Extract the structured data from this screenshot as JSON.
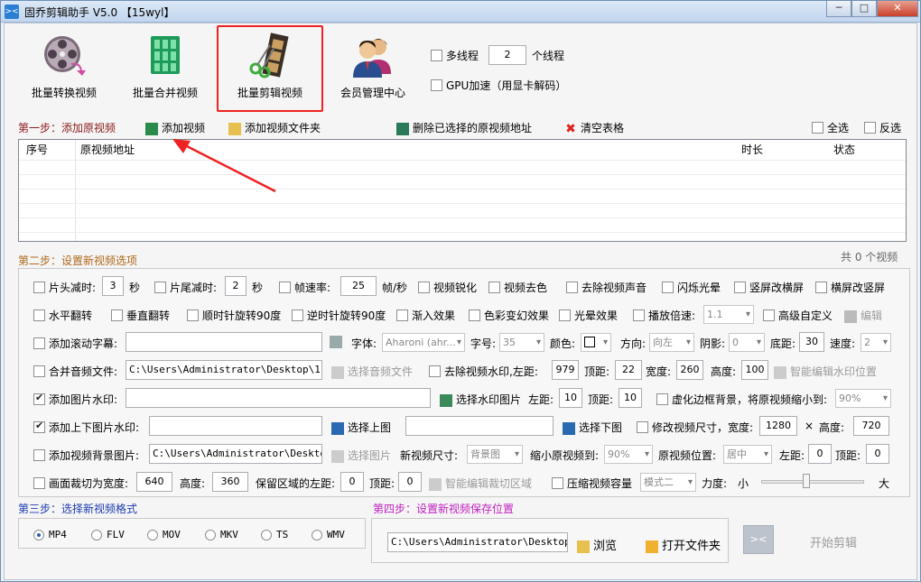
{
  "window": {
    "title": "固乔剪辑助手 V5.0  【15wyl】",
    "min": "─",
    "max": "□",
    "close": "✕"
  },
  "toolbar": {
    "convert": "批量转换视频",
    "merge": "批量合并视频",
    "clip": "批量剪辑视频",
    "member": "会员管理中心",
    "multithread": "多线程",
    "threads": "2",
    "threads_unit": "个线程",
    "gpu": "GPU加速（用显卡解码）"
  },
  "step1": {
    "title": "第一步：添加原视频",
    "add_video": "添加视频",
    "add_folder": "添加视频文件夹",
    "delete_selected": "删除已选择的原视频地址",
    "clear_table": "清空表格",
    "select_all": "全选",
    "invert": "反选"
  },
  "table": {
    "columns": [
      "序号",
      "原视频地址",
      "时长",
      "状态"
    ],
    "count": "共 0 个视频"
  },
  "step2": {
    "title": "第二步：设置新视频选项",
    "row1": {
      "head_cut": "片头减时:",
      "head_val": "3",
      "sec1": "秒",
      "tail_cut": "片尾减时:",
      "tail_val": "2",
      "sec2": "秒",
      "fps": "帧速率:",
      "fps_val": "25",
      "fps_unit": "帧/秒",
      "sharpen": "视频锐化",
      "decolor": "视频去色",
      "mute": "去除视频声音",
      "flash": "闪烁光晕",
      "v2h": "竖屏改横屏",
      "h2v": "横屏改竖屏"
    },
    "row2": {
      "hflip": "水平翻转",
      "vflip": "垂直翻转",
      "cw90": "顺时针旋转90度",
      "ccw90": "逆时针旋转90度",
      "fadein": "渐入效果",
      "color": "色彩变幻效果",
      "halo": "光晕效果",
      "speed": "播放倍速:",
      "speed_val": "1.1",
      "advanced": "高级自定义",
      "edit": "编辑"
    },
    "row3": {
      "subtitle": "添加滚动字幕:",
      "subtitle_val": "",
      "font": "字体:",
      "font_val": "Aharoni (ahr...",
      "size": "字号:",
      "size_val": "35",
      "color": "颜色:",
      "direction": "方向:",
      "direction_val": "向左",
      "shadow": "阴影:",
      "shadow_val": "0",
      "bottom": "底距:",
      "bottom_val": "30",
      "speed": "速度:",
      "speed_val": "2"
    },
    "row4": {
      "audio": "合并音频文件:",
      "audio_val": "C:\\Users\\Administrator\\Desktop\\1.mp3",
      "choose_audio": "选择音频文件",
      "remove_wm": "去除视频水印,左距:",
      "left_val": "979",
      "top": "顶距:",
      "top_val": "22",
      "width": "宽度:",
      "width_val": "260",
      "height": "高度:",
      "height_val": "100",
      "smart_wm": "智能编辑水印位置"
    },
    "row5": {
      "img_wm": "添加图片水印:",
      "img_wm_val": "",
      "choose_wm": "选择水印图片",
      "left": "左距:",
      "left_val": "10",
      "top": "顶距:",
      "top_val": "10",
      "blur_bg": "虚化边框背景，将原视频缩小到:",
      "blur_val": "90%"
    },
    "row6": {
      "updown": "添加上下图片水印:",
      "up_val": "",
      "choose_up": "选择上图",
      "down_val": "",
      "choose_down": "选择下图",
      "resize": "修改视频尺寸，宽度:",
      "w_val": "1280",
      "x": "×",
      "h": "高度:",
      "h_val": "720"
    },
    "row7": {
      "bg_img": "添加视频背景图片:",
      "bg_val": "C:\\Users\\Administrator\\Desktop\\t",
      "choose_img": "选择图片",
      "new_size": "新视频尺寸:",
      "new_size_val": "背景图",
      "shrink": "缩小原视频到:",
      "shrink_val": "90%",
      "pos": "原视频位置:",
      "pos_val": "居中",
      "left": "左距:",
      "left_val": "0",
      "top": "顶距:",
      "top_val": "0"
    },
    "row8": {
      "crop": "画面裁切为宽度:",
      "crop_w": "640",
      "height": "高度:",
      "crop_h": "360",
      "keep_left": "保留区域的左距:",
      "keep_left_val": "0",
      "top": "顶距:",
      "top_val": "0",
      "smart_crop": "智能编辑裁切区域",
      "compress": "压缩视频容量",
      "mode_val": "模式二",
      "force": "力度:",
      "small": "小",
      "big": "大",
      "force_level": 0.43
    }
  },
  "step3": {
    "title": "第三步：选择新视频格式",
    "formats": [
      "MP4",
      "FLV",
      "MOV",
      "MKV",
      "TS",
      "WMV"
    ],
    "selected": "MP4"
  },
  "step4": {
    "title": "第四步：设置新视频保存位置",
    "path": "C:\\Users\\Administrator\\Desktop\\新",
    "browse": "浏览",
    "open_folder": "打开文件夹",
    "start": "开始剪辑"
  }
}
